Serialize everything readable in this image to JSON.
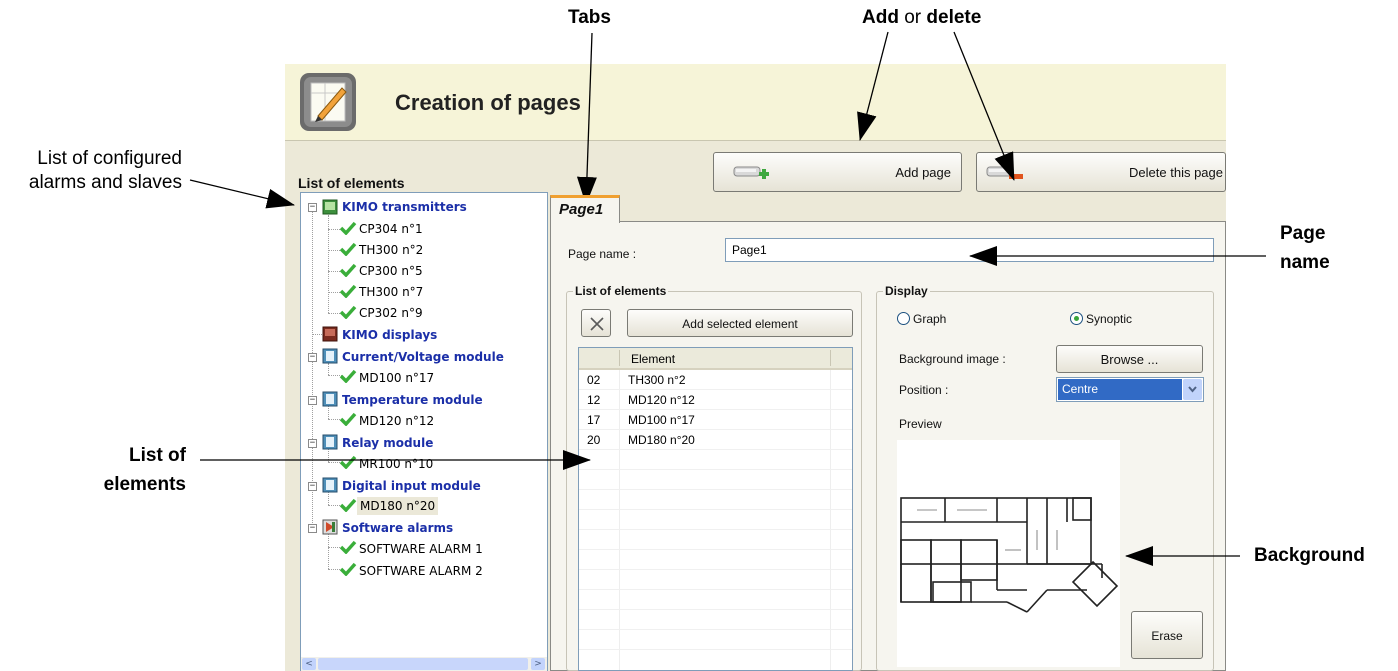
{
  "callouts": {
    "tabs": "Tabs",
    "add_bold": "Add",
    "or": " or ",
    "delete_bold": "delete",
    "list_configured_1": "List of configured",
    "list_configured_2": "alarms and slaves",
    "page_name_1": "Page",
    "page_name_2": "name",
    "list_elements_1": "List of",
    "list_elements_2": "elements",
    "background": "Background"
  },
  "header": {
    "title": "Creation of pages"
  },
  "toolbar": {
    "add_page": "Add page",
    "delete_page": "Delete this page"
  },
  "sidebar": {
    "heading": "List of elements",
    "groups": [
      {
        "label": "KIMO transmitters",
        "icon": "transmitter-icon",
        "items": [
          "CP304 n°1",
          "TH300 n°2",
          "CP300 n°5",
          "TH300 n°7",
          "CP302 n°9"
        ]
      },
      {
        "label": "KIMO displays",
        "icon": "display-icon",
        "items": []
      },
      {
        "label": "Current/Voltage module",
        "icon": "module-icon",
        "items": [
          "MD100 n°17"
        ]
      },
      {
        "label": "Temperature module",
        "icon": "module-icon",
        "items": [
          "MD120 n°12"
        ]
      },
      {
        "label": "Relay module",
        "icon": "module-icon",
        "items": [
          "MR100 n°10"
        ]
      },
      {
        "label": "Digital input module",
        "icon": "module-icon",
        "items": [
          "MD180 n°20"
        ]
      },
      {
        "label": "Software alarms",
        "icon": "software-alarm-icon",
        "items": [
          "SOFTWARE ALARM 1",
          "SOFTWARE ALARM 2"
        ]
      }
    ]
  },
  "tabs": [
    {
      "label": "Page1"
    }
  ],
  "form": {
    "page_name_label": "Page name :",
    "page_name_value": "Page1"
  },
  "elements_panel": {
    "legend": "List of elements",
    "add_selected": "Add selected element",
    "column_header": "Element",
    "rows": [
      {
        "id": "02",
        "name": "TH300 n°2"
      },
      {
        "id": "12",
        "name": "MD120 n°12"
      },
      {
        "id": "17",
        "name": "MD100 n°17"
      },
      {
        "id": "20",
        "name": "MD180 n°20"
      }
    ]
  },
  "display_panel": {
    "legend": "Display",
    "radio_graph": "Graph",
    "radio_synoptic": "Synoptic",
    "selected": "Synoptic",
    "background_image_label": "Background image :",
    "browse": "Browse ...",
    "position_label": "Position :",
    "position_value": "Centre",
    "preview_label": "Preview",
    "erase": "Erase"
  }
}
